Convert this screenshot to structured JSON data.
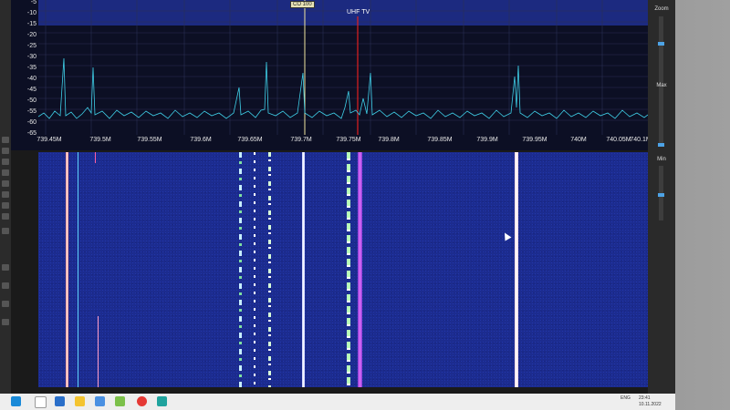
{
  "app": {
    "band_label": "UHF TV",
    "marker_label": "CO 100"
  },
  "spectrum": {
    "db_labels": [
      "-5",
      "-10",
      "-15",
      "-20",
      "-25",
      "-30",
      "-35",
      "-40",
      "-45",
      "-50",
      "-55",
      "-60",
      "-65"
    ],
    "freq_labels": [
      "739.45M",
      "739.5M",
      "739.55M",
      "739.6M",
      "739.65M",
      "739.7M",
      "739.75M",
      "739.8M",
      "739.85M",
      "739.9M",
      "739.95M",
      "740M",
      "740.05M",
      "740.1M"
    ]
  },
  "right_panel": {
    "zoom_label": "Zoom",
    "max_label": "Max",
    "min_label": "Min"
  },
  "taskbar": {
    "tray_lang": "ENG",
    "tray_time": "23:41",
    "tray_date": "10.11.2022"
  },
  "colors": {
    "spectrum_trace": "#3fd0e8",
    "waterfall_bg": "#1c2c8f",
    "marker_line": "#f0e6a0",
    "red_marker": "#e02020"
  }
}
